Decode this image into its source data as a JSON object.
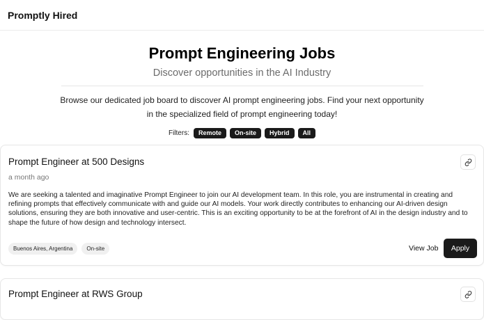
{
  "header": {
    "brand": "Promptly Hired"
  },
  "hero": {
    "title": "Prompt Engineering Jobs",
    "subtitle": "Discover opportunities in the AI Industry",
    "description": "Browse our dedicated job board to discover AI prompt engineering jobs. Find your next opportunity in the specialized field of prompt engineering today!"
  },
  "filters": {
    "label": "Filters:",
    "options": [
      "Remote",
      "On-site",
      "Hybrid",
      "All"
    ]
  },
  "jobs": [
    {
      "title": "Prompt Engineer at 500 Designs",
      "posted": "a month ago",
      "description": "We are seeking a talented and imaginative Prompt Engineer to join our AI development team. In this role, you are instrumental in creating and refining prompts that effectively communicate with and guide our AI models. Your work directly contributes to enhancing our AI-driven design solutions, ensuring they are both innovative and user-centric. This is an exciting opportunity to be at the forefront of AI in the design industry and to shape the future of how design and technology intersect.",
      "location": "Buenos Aires, Argentina",
      "work_type": "On-site",
      "view_label": "View Job",
      "apply_label": "Apply"
    },
    {
      "title": "Prompt Engineer at RWS Group"
    }
  ],
  "icons": {
    "copy_link": "link-icon"
  },
  "colors": {
    "primary": "#1a1a1a",
    "muted_text": "#6b6b6b",
    "tag_bg": "#f0f0f0"
  }
}
